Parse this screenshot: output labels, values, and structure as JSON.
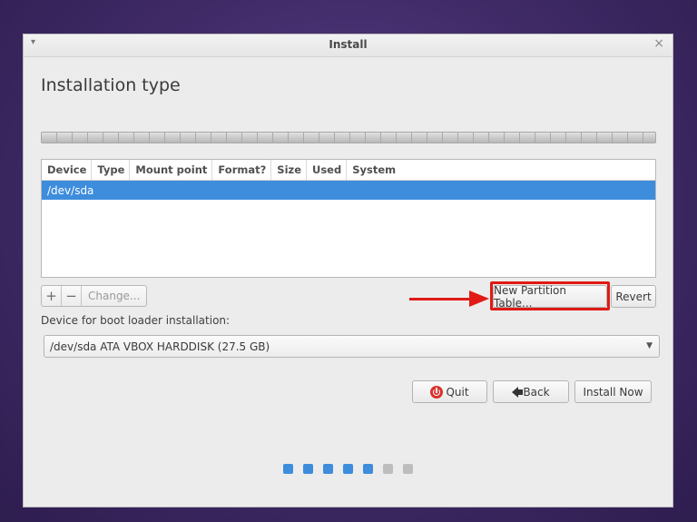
{
  "window": {
    "title": "Install",
    "menu_glyph": "▾",
    "close_glyph": "×"
  },
  "page": {
    "heading": "Installation type"
  },
  "partition_table": {
    "columns": [
      "Device",
      "Type",
      "Mount point",
      "Format?",
      "Size",
      "Used",
      "System"
    ],
    "rows": [
      {
        "device": "/dev/sda",
        "selected": true
      }
    ]
  },
  "toolbar": {
    "add_label": "+",
    "remove_label": "−",
    "change_label": "Change...",
    "new_partition_table_label": "New Partition Table...",
    "revert_label": "Revert"
  },
  "bootloader": {
    "label": "Device for boot loader installation:",
    "selected": "/dev/sda ATA VBOX HARDDISK (27.5 GB)"
  },
  "actions": {
    "quit_label": "Quit",
    "back_label": "Back",
    "install_label": "Install Now"
  },
  "progress": {
    "total_steps": 7,
    "completed_steps": 5
  },
  "colors": {
    "accent": "#3e8ddd",
    "annotation": "#e01a14",
    "quit_icon": "#d9302c"
  },
  "icons": {
    "quit": "power-icon",
    "back": "back-arrow-icon",
    "combo": "chevron-down-icon"
  }
}
